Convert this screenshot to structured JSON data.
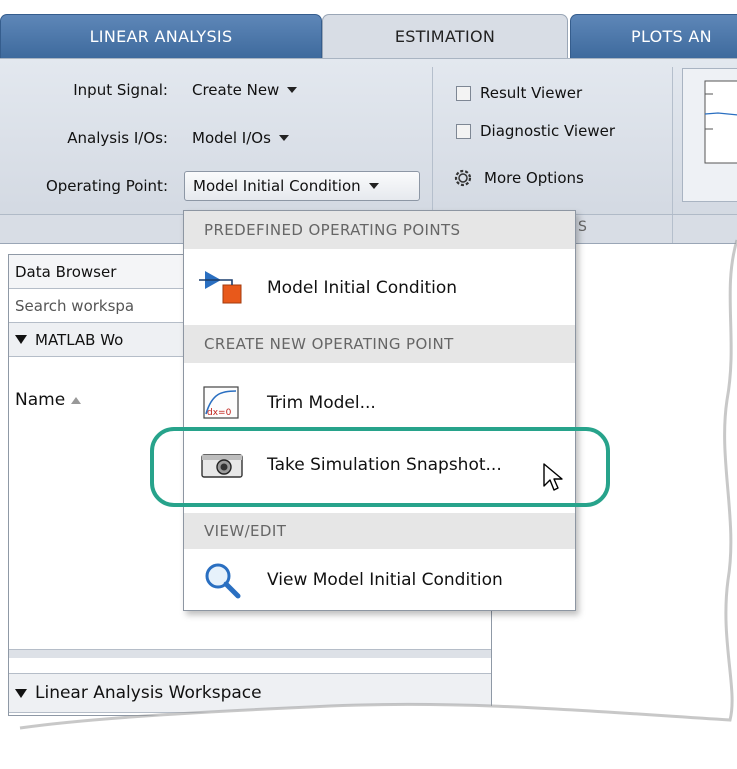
{
  "tabs": [
    {
      "label": "LINEAR ANALYSIS",
      "active": false
    },
    {
      "label": "ESTIMATION",
      "active": true
    },
    {
      "label": "PLOTS AN",
      "active": false
    }
  ],
  "toolstrip": {
    "input_signal": {
      "label": "Input Signal:",
      "value": "Create New"
    },
    "analysis_ios": {
      "label": "Analysis I/Os:",
      "value": "Model I/Os"
    },
    "operating_point": {
      "label": "Operating Point:",
      "value": "Model Initial Condition"
    },
    "result_viewer": {
      "label": "Result Viewer",
      "checked": false
    },
    "diagnostic_viewer": {
      "label": "Diagnostic Viewer",
      "checked": false
    },
    "more_options": {
      "label": "More Options",
      "icon": "gear-icon"
    },
    "section_fragment": "S"
  },
  "data_browser": {
    "title": "Data Browser",
    "search_placeholder": "Search workspa",
    "matlab_workspace_header": "MATLAB Wo",
    "name_column": "Name",
    "linear_workspace_header": "Linear Analysis Workspace"
  },
  "menu": {
    "section_predefined": "PREDEFINED OPERATING POINTS",
    "item_model_initial": "Model Initial Condition",
    "section_create": "CREATE NEW OPERATING POINT",
    "item_trim": "Trim Model...",
    "trim_icon_text": "dx=0",
    "item_snapshot": "Take Simulation Snapshot...",
    "section_view": "VIEW/EDIT",
    "item_view": "View Model Initial Condition"
  },
  "colors": {
    "highlight_ring": "#27a38b",
    "tab_blue": "#4a75a8",
    "icon_orange": "#e8591b",
    "icon_blue": "#2a6fc1"
  }
}
